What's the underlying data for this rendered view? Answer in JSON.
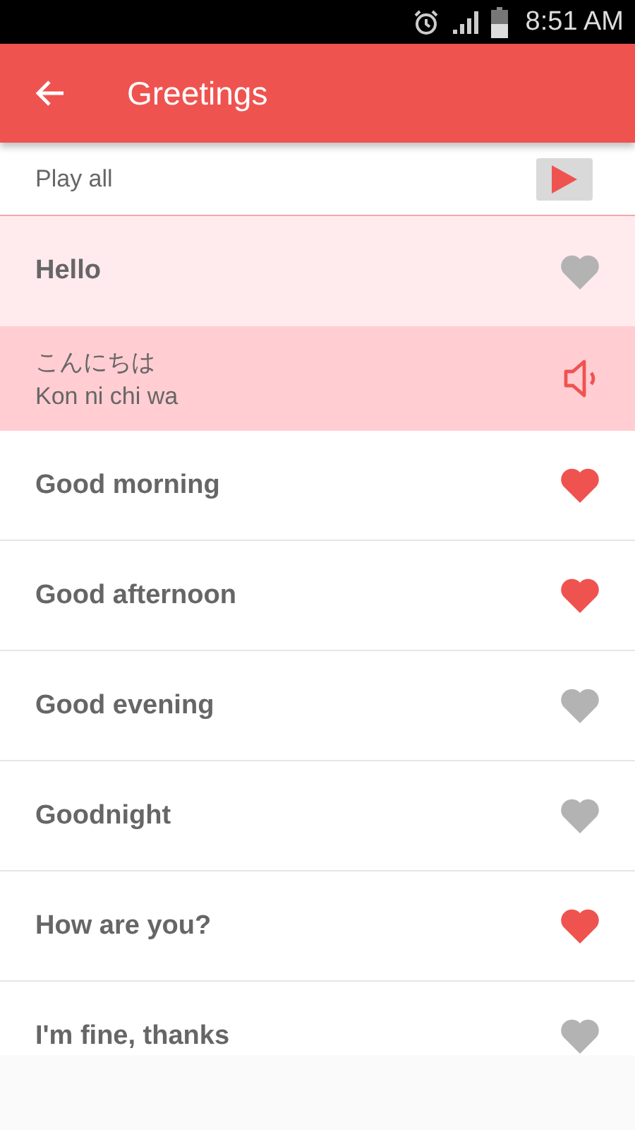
{
  "status_bar": {
    "time": "8:51 AM"
  },
  "toolbar": {
    "title": "Greetings"
  },
  "play_all": {
    "label": "Play all"
  },
  "phrases": [
    {
      "text": "Hello",
      "favorite": false,
      "expanded": true,
      "translation": {
        "native": "こんにちは",
        "romaji": "Kon ni chi wa"
      }
    },
    {
      "text": "Good morning",
      "favorite": true,
      "expanded": false
    },
    {
      "text": "Good afternoon",
      "favorite": true,
      "expanded": false
    },
    {
      "text": "Good evening",
      "favorite": false,
      "expanded": false
    },
    {
      "text": "Goodnight",
      "favorite": false,
      "expanded": false
    },
    {
      "text": "How are you?",
      "favorite": true,
      "expanded": false
    },
    {
      "text": "I'm fine, thanks",
      "favorite": false,
      "expanded": false
    }
  ]
}
